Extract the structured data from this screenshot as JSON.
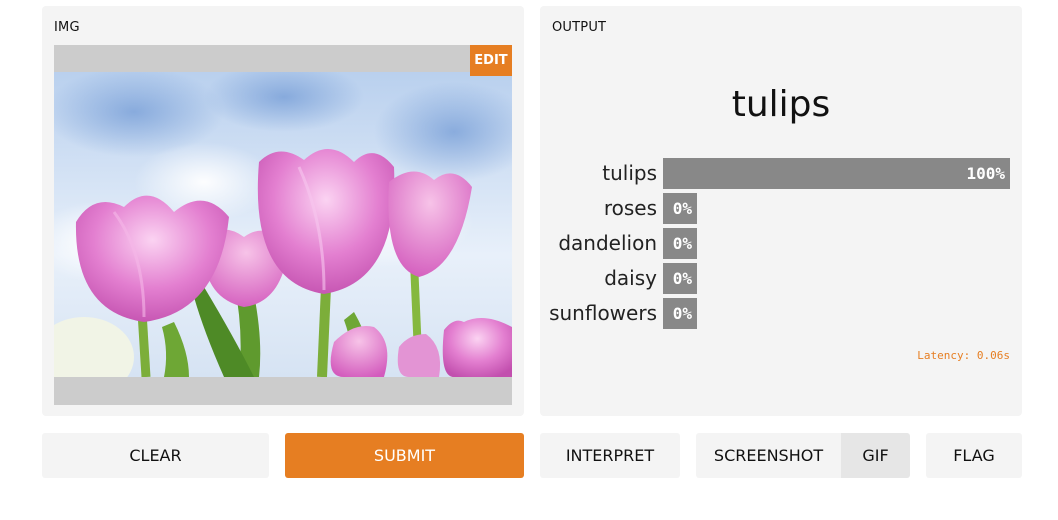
{
  "input_panel": {
    "title": "IMG",
    "edit_label": "EDIT"
  },
  "output_panel": {
    "title": "OUTPUT",
    "prediction": "tulips",
    "bars": [
      {
        "label": "tulips",
        "value_text": "100%",
        "fraction": 1.0
      },
      {
        "label": "roses",
        "value_text": "0%",
        "fraction": 0.0
      },
      {
        "label": "dandelion",
        "value_text": "0%",
        "fraction": 0.0
      },
      {
        "label": "daisy",
        "value_text": "0%",
        "fraction": 0.0
      },
      {
        "label": "sunflowers",
        "value_text": "0%",
        "fraction": 0.0
      }
    ],
    "latency": "Latency: 0.06s"
  },
  "buttons": {
    "clear": "CLEAR",
    "submit": "SUBMIT",
    "interpret": "INTERPRET",
    "screenshot": "SCREENSHOT",
    "gif": "GIF",
    "flag": "FLAG"
  },
  "colors": {
    "accent": "#e67e22",
    "bar": "#888888",
    "panel": "#f4f4f4"
  }
}
